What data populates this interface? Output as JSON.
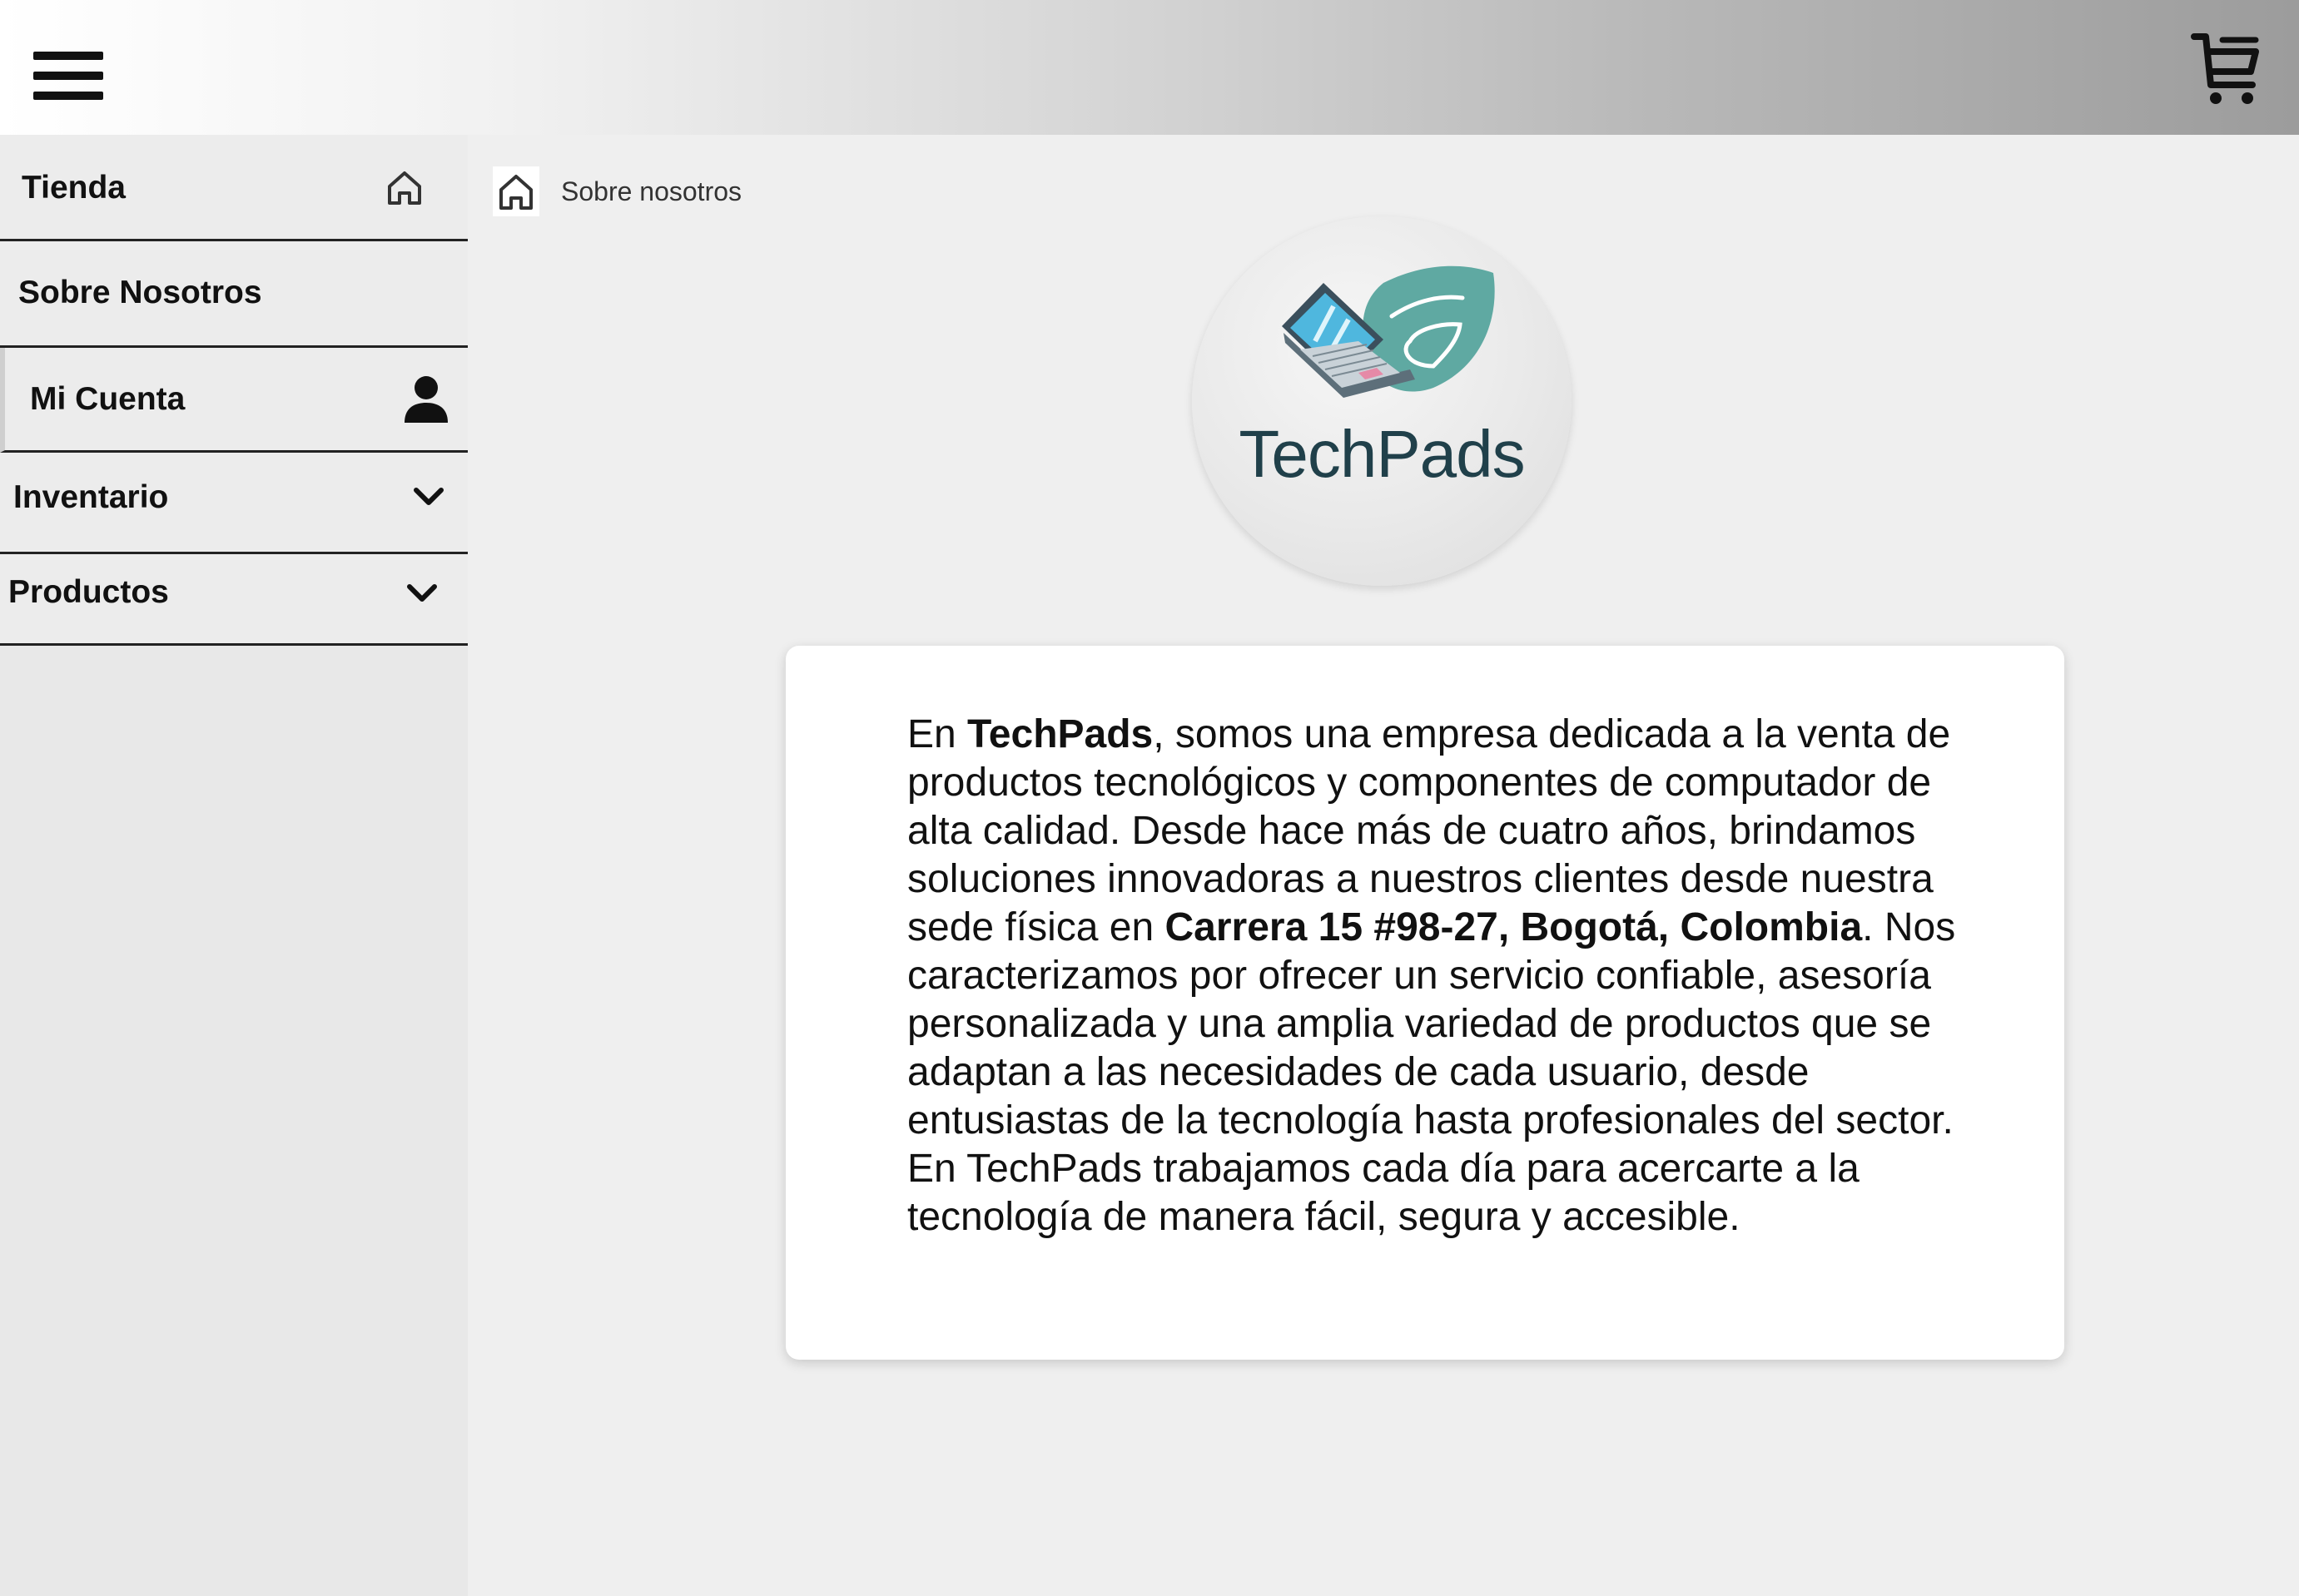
{
  "header": {
    "menu_icon": "hamburger-menu-icon",
    "cart_icon": "shopping-cart-icon"
  },
  "sidebar": {
    "items": [
      {
        "label": "Tienda",
        "icon": "home-icon"
      },
      {
        "label": "Sobre Nosotros"
      },
      {
        "label": "Mi Cuenta",
        "icon": "user-icon"
      },
      {
        "label": "Inventario",
        "icon": "chevron-down-icon"
      },
      {
        "label": "Productos",
        "icon": "chevron-down-icon"
      }
    ]
  },
  "breadcrumb": {
    "home_icon": "home-icon",
    "current": "Sobre nosotros"
  },
  "logo": {
    "brand": "TechPads"
  },
  "about": {
    "p1": "En ",
    "brand": "TechPads",
    "p2": ", somos una empresa dedicada a la venta de productos tecnológicos y componentes de computador de alta calidad. Desde hace más de cuatro años, brindamos soluciones innovadoras a nuestros clientes desde nuestra sede física en ",
    "address": "Carrera 15 #98-27, Bogotá, Colombia",
    "p3": ". Nos caracterizamos por ofrecer un servicio confiable, asesoría personalizada y una amplia variedad de productos que se adaptan a las necesidades de cada usuario, desde entusiastas de la tecnología hasta profesionales del sector. En TechPads trabajamos cada día para acercarte a la tecnología de manera fácil, segura y accesible."
  }
}
